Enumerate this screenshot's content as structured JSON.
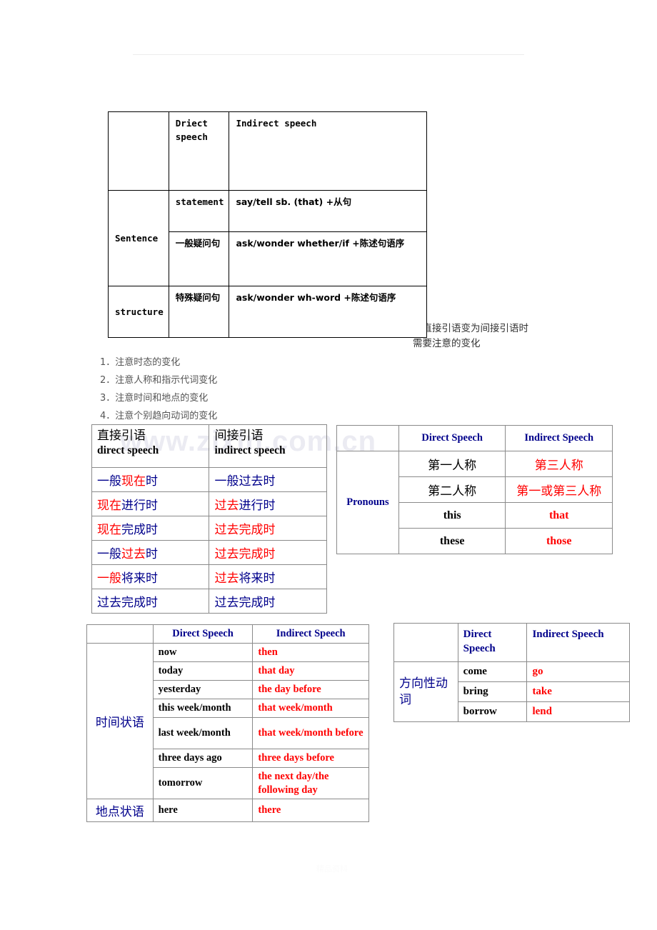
{
  "watermark": "www.zixin.com.cn",
  "footer_faint": "精品资料",
  "structure_table": {
    "header": {
      "corner": "",
      "direct": "Driect speech",
      "indirect": "Indirect speech"
    },
    "row_label_top": "Sentence",
    "row_label_bottom": "structure",
    "rows": [
      {
        "type": "statement",
        "formula": "say/tell sb. (that) +从句"
      },
      {
        "type": "一般疑问句",
        "formula": "ask/wonder whether/if +陈述句语序"
      },
      {
        "type": "特殊疑问句",
        "formula": "ask/wonder wh-word +陈述句语序"
      }
    ]
  },
  "annotation": {
    "line1": "在直接引语变为间接引语时",
    "line2": "需要注意的变化"
  },
  "notes": [
    "1．注意时态的变化",
    "2．注意人称和指示代词变化",
    "3．注意时间和地点的变化",
    "4．注意个别趋向动词的变化"
  ],
  "tense_table": {
    "header": {
      "left_cn": "直接引语",
      "left_en": "direct speech",
      "right_cn": "间接引语",
      "right_en": "indirect speech"
    },
    "rows": [
      {
        "direct": [
          {
            "t": "一般",
            "c": "blue"
          },
          {
            "t": "现在",
            "c": "red"
          },
          {
            "t": "时",
            "c": "blue"
          }
        ],
        "indirect": [
          {
            "t": "一般过去时",
            "c": "blue"
          }
        ]
      },
      {
        "direct": [
          {
            "t": "现在",
            "c": "red"
          },
          {
            "t": "进行时",
            "c": "blue"
          }
        ],
        "indirect": [
          {
            "t": "过去",
            "c": "red"
          },
          {
            "t": "进行时",
            "c": "blue"
          }
        ]
      },
      {
        "direct": [
          {
            "t": "现在",
            "c": "red"
          },
          {
            "t": "完成时",
            "c": "blue"
          }
        ],
        "indirect": [
          {
            "t": "过去完成时",
            "c": "red"
          }
        ]
      },
      {
        "direct": [
          {
            "t": "一般",
            "c": "blue"
          },
          {
            "t": "过去",
            "c": "red"
          },
          {
            "t": "时",
            "c": "blue"
          }
        ],
        "indirect": [
          {
            "t": "过去完成时",
            "c": "red"
          }
        ]
      },
      {
        "direct": [
          {
            "t": "一般",
            "c": "red"
          },
          {
            "t": "将来时",
            "c": "blue"
          }
        ],
        "indirect": [
          {
            "t": "过去",
            "c": "red"
          },
          {
            "t": "将来时",
            "c": "blue"
          }
        ]
      },
      {
        "direct": [
          {
            "t": "过去完成时",
            "c": "blue"
          }
        ],
        "indirect": [
          {
            "t": "过去完成时",
            "c": "blue"
          }
        ]
      }
    ]
  },
  "pronouns_table": {
    "label": "Pronouns",
    "header": {
      "direct": "Direct Speech",
      "indirect": "Indirect Speech"
    },
    "rows": [
      {
        "direct": "第一人称",
        "indirect": "第三人称",
        "cjk": true
      },
      {
        "direct": "第二人称",
        "indirect": "第一或第三人称",
        "cjk": true
      },
      {
        "direct": "this",
        "indirect": "that",
        "cjk": false
      },
      {
        "direct": "these",
        "indirect": "those",
        "cjk": false
      }
    ]
  },
  "time_table": {
    "header": {
      "direct": "Direct Speech",
      "indirect": "Indirect Speech"
    },
    "label_time": "时间状语",
    "label_place": "地点状语",
    "rows": [
      {
        "direct": "now",
        "indirect": "then"
      },
      {
        "direct": "today",
        "indirect": "that day"
      },
      {
        "direct": "yesterday",
        "indirect": "the day before"
      },
      {
        "direct": "this week/month",
        "indirect": "that week/month"
      },
      {
        "direct": "last week/month",
        "indirect": "that week/month before"
      },
      {
        "direct": "three days ago",
        "indirect": "three days before"
      },
      {
        "direct": "tomorrow",
        "indirect": "the next day/the following day"
      }
    ],
    "place_row": {
      "direct": "here",
      "indirect": "there"
    }
  },
  "verbs_table": {
    "label": "方向性动词",
    "header": {
      "direct": "Direct Speech",
      "indirect": "Indirect Speech"
    },
    "rows": [
      {
        "direct": "come",
        "indirect": "go"
      },
      {
        "direct": "bring",
        "indirect": "take"
      },
      {
        "direct": "borrow",
        "indirect": "lend"
      }
    ]
  },
  "colors": {
    "blue": "#00008B",
    "red": "#FF0000",
    "black": "#000000"
  }
}
